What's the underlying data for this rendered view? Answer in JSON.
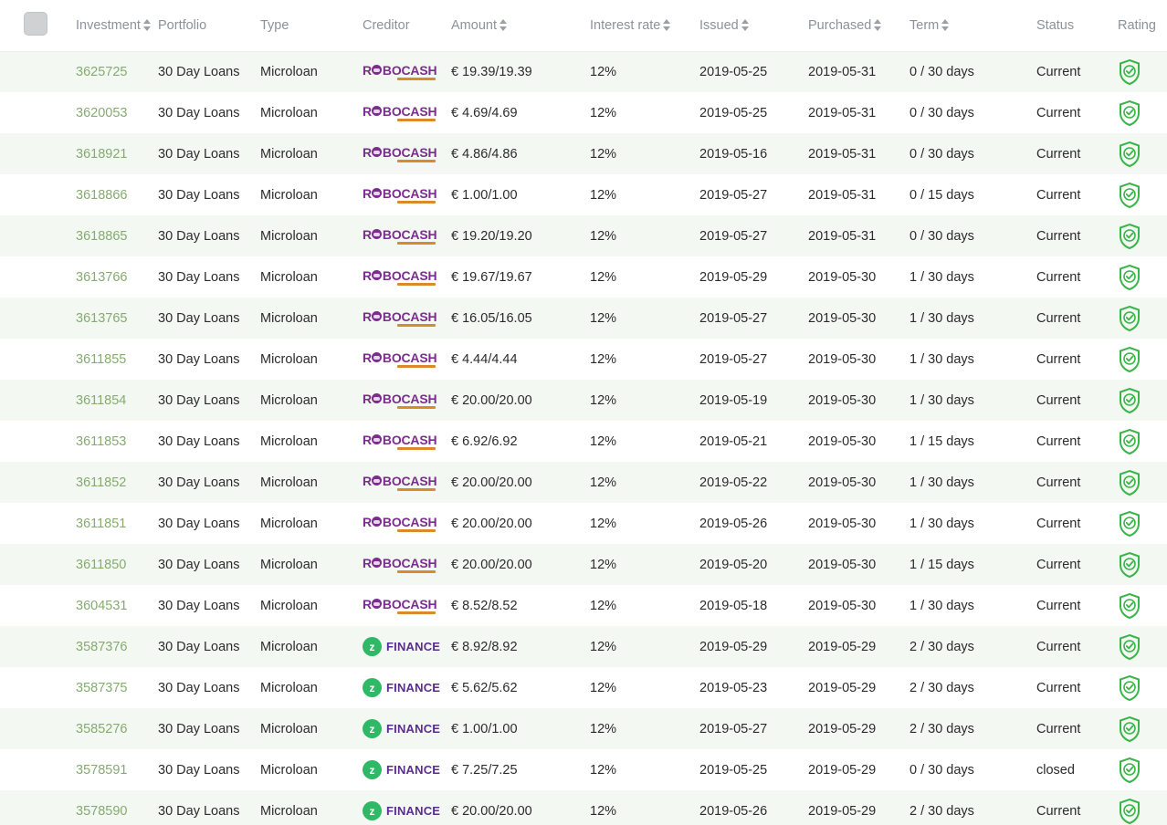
{
  "table": {
    "select_all_checkbox_name": "select-all-rows",
    "columns": [
      {
        "key": "investment",
        "label": "Investment",
        "sortable": true
      },
      {
        "key": "portfolio",
        "label": "Portfolio",
        "sortable": false
      },
      {
        "key": "type",
        "label": "Type",
        "sortable": false
      },
      {
        "key": "creditor",
        "label": "Creditor",
        "sortable": false
      },
      {
        "key": "amount",
        "label": "Amount",
        "sortable": true
      },
      {
        "key": "interest_rate",
        "label": "Interest rate",
        "sortable": true
      },
      {
        "key": "issued",
        "label": "Issued",
        "sortable": true
      },
      {
        "key": "purchased",
        "label": "Purchased",
        "sortable": true
      },
      {
        "key": "term",
        "label": "Term",
        "sortable": true
      },
      {
        "key": "status",
        "label": "Status",
        "sortable": false
      },
      {
        "key": "rating",
        "label": "Rating",
        "sortable": false
      }
    ],
    "colors": {
      "investment_link": "#85ab6f",
      "row_alt_background": "#f4f8f2",
      "row_background": "#ffffff",
      "header_text": "#8d9298",
      "rating_shield": "#3ab54a",
      "robocash_purple": "#7b2d8e",
      "robocash_orange": "#d98a2b",
      "zfinance_green": "#2fb866",
      "zfinance_purple": "#5b2d8e"
    },
    "rows": [
      {
        "investment": "3625725",
        "portfolio": "30 Day Loans",
        "type": "Microloan",
        "creditor": "robocash",
        "creditor_label": "ROBOCASH",
        "amount": "€ 19.39/19.39",
        "interest_rate": "12%",
        "issued": "2019-05-25",
        "purchased": "2019-05-31",
        "term": "0 / 30 days",
        "status": "Current",
        "rating": "shield-check-icon"
      },
      {
        "investment": "3620053",
        "portfolio": "30 Day Loans",
        "type": "Microloan",
        "creditor": "robocash",
        "creditor_label": "ROBOCASH",
        "amount": "€ 4.69/4.69",
        "interest_rate": "12%",
        "issued": "2019-05-25",
        "purchased": "2019-05-31",
        "term": "0 / 30 days",
        "status": "Current",
        "rating": "shield-check-icon"
      },
      {
        "investment": "3618921",
        "portfolio": "30 Day Loans",
        "type": "Microloan",
        "creditor": "robocash",
        "creditor_label": "ROBOCASH",
        "amount": "€ 4.86/4.86",
        "interest_rate": "12%",
        "issued": "2019-05-16",
        "purchased": "2019-05-31",
        "term": "0 / 30 days",
        "status": "Current",
        "rating": "shield-check-icon"
      },
      {
        "investment": "3618866",
        "portfolio": "30 Day Loans",
        "type": "Microloan",
        "creditor": "robocash",
        "creditor_label": "ROBOCASH",
        "amount": "€ 1.00/1.00",
        "interest_rate": "12%",
        "issued": "2019-05-27",
        "purchased": "2019-05-31",
        "term": "0 / 15 days",
        "status": "Current",
        "rating": "shield-check-icon"
      },
      {
        "investment": "3618865",
        "portfolio": "30 Day Loans",
        "type": "Microloan",
        "creditor": "robocash",
        "creditor_label": "ROBOCASH",
        "amount": "€ 19.20/19.20",
        "interest_rate": "12%",
        "issued": "2019-05-27",
        "purchased": "2019-05-31",
        "term": "0 / 30 days",
        "status": "Current",
        "rating": "shield-check-icon"
      },
      {
        "investment": "3613766",
        "portfolio": "30 Day Loans",
        "type": "Microloan",
        "creditor": "robocash",
        "creditor_label": "ROBOCASH",
        "amount": "€ 19.67/19.67",
        "interest_rate": "12%",
        "issued": "2019-05-29",
        "purchased": "2019-05-30",
        "term": "1 / 30 days",
        "status": "Current",
        "rating": "shield-check-icon"
      },
      {
        "investment": "3613765",
        "portfolio": "30 Day Loans",
        "type": "Microloan",
        "creditor": "robocash",
        "creditor_label": "ROBOCASH",
        "amount": "€ 16.05/16.05",
        "interest_rate": "12%",
        "issued": "2019-05-27",
        "purchased": "2019-05-30",
        "term": "1 / 30 days",
        "status": "Current",
        "rating": "shield-check-icon"
      },
      {
        "investment": "3611855",
        "portfolio": "30 Day Loans",
        "type": "Microloan",
        "creditor": "robocash",
        "creditor_label": "ROBOCASH",
        "amount": "€ 4.44/4.44",
        "interest_rate": "12%",
        "issued": "2019-05-27",
        "purchased": "2019-05-30",
        "term": "1 / 30 days",
        "status": "Current",
        "rating": "shield-check-icon"
      },
      {
        "investment": "3611854",
        "portfolio": "30 Day Loans",
        "type": "Microloan",
        "creditor": "robocash",
        "creditor_label": "ROBOCASH",
        "amount": "€ 20.00/20.00",
        "interest_rate": "12%",
        "issued": "2019-05-19",
        "purchased": "2019-05-30",
        "term": "1 / 30 days",
        "status": "Current",
        "rating": "shield-check-icon"
      },
      {
        "investment": "3611853",
        "portfolio": "30 Day Loans",
        "type": "Microloan",
        "creditor": "robocash",
        "creditor_label": "ROBOCASH",
        "amount": "€ 6.92/6.92",
        "interest_rate": "12%",
        "issued": "2019-05-21",
        "purchased": "2019-05-30",
        "term": "1 / 15 days",
        "status": "Current",
        "rating": "shield-check-icon"
      },
      {
        "investment": "3611852",
        "portfolio": "30 Day Loans",
        "type": "Microloan",
        "creditor": "robocash",
        "creditor_label": "ROBOCASH",
        "amount": "€ 20.00/20.00",
        "interest_rate": "12%",
        "issued": "2019-05-22",
        "purchased": "2019-05-30",
        "term": "1 / 30 days",
        "status": "Current",
        "rating": "shield-check-icon"
      },
      {
        "investment": "3611851",
        "portfolio": "30 Day Loans",
        "type": "Microloan",
        "creditor": "robocash",
        "creditor_label": "ROBOCASH",
        "amount": "€ 20.00/20.00",
        "interest_rate": "12%",
        "issued": "2019-05-26",
        "purchased": "2019-05-30",
        "term": "1 / 30 days",
        "status": "Current",
        "rating": "shield-check-icon"
      },
      {
        "investment": "3611850",
        "portfolio": "30 Day Loans",
        "type": "Microloan",
        "creditor": "robocash",
        "creditor_label": "ROBOCASH",
        "amount": "€ 20.00/20.00",
        "interest_rate": "12%",
        "issued": "2019-05-20",
        "purchased": "2019-05-30",
        "term": "1 / 15 days",
        "status": "Current",
        "rating": "shield-check-icon"
      },
      {
        "investment": "3604531",
        "portfolio": "30 Day Loans",
        "type": "Microloan",
        "creditor": "robocash",
        "creditor_label": "ROBOCASH",
        "amount": "€ 8.52/8.52",
        "interest_rate": "12%",
        "issued": "2019-05-18",
        "purchased": "2019-05-30",
        "term": "1 / 30 days",
        "status": "Current",
        "rating": "shield-check-icon"
      },
      {
        "investment": "3587376",
        "portfolio": "30 Day Loans",
        "type": "Microloan",
        "creditor": "zfinance",
        "creditor_label": "Z FINANCE",
        "amount": "€ 8.92/8.92",
        "interest_rate": "12%",
        "issued": "2019-05-29",
        "purchased": "2019-05-29",
        "term": "2 / 30 days",
        "status": "Current",
        "rating": "shield-check-icon"
      },
      {
        "investment": "3587375",
        "portfolio": "30 Day Loans",
        "type": "Microloan",
        "creditor": "zfinance",
        "creditor_label": "Z FINANCE",
        "amount": "€ 5.62/5.62",
        "interest_rate": "12%",
        "issued": "2019-05-23",
        "purchased": "2019-05-29",
        "term": "2 / 30 days",
        "status": "Current",
        "rating": "shield-check-icon"
      },
      {
        "investment": "3585276",
        "portfolio": "30 Day Loans",
        "type": "Microloan",
        "creditor": "zfinance",
        "creditor_label": "Z FINANCE",
        "amount": "€ 1.00/1.00",
        "interest_rate": "12%",
        "issued": "2019-05-27",
        "purchased": "2019-05-29",
        "term": "2 / 30 days",
        "status": "Current",
        "rating": "shield-check-icon"
      },
      {
        "investment": "3578591",
        "portfolio": "30 Day Loans",
        "type": "Microloan",
        "creditor": "zfinance",
        "creditor_label": "Z FINANCE",
        "amount": "€ 7.25/7.25",
        "interest_rate": "12%",
        "issued": "2019-05-25",
        "purchased": "2019-05-29",
        "term": "0 / 30 days",
        "status": "closed",
        "rating": "shield-check-icon"
      },
      {
        "investment": "3578590",
        "portfolio": "30 Day Loans",
        "type": "Microloan",
        "creditor": "zfinance",
        "creditor_label": "Z FINANCE",
        "amount": "€ 20.00/20.00",
        "interest_rate": "12%",
        "issued": "2019-05-26",
        "purchased": "2019-05-29",
        "term": "2 / 30 days",
        "status": "Current",
        "rating": "shield-check-icon"
      }
    ]
  }
}
